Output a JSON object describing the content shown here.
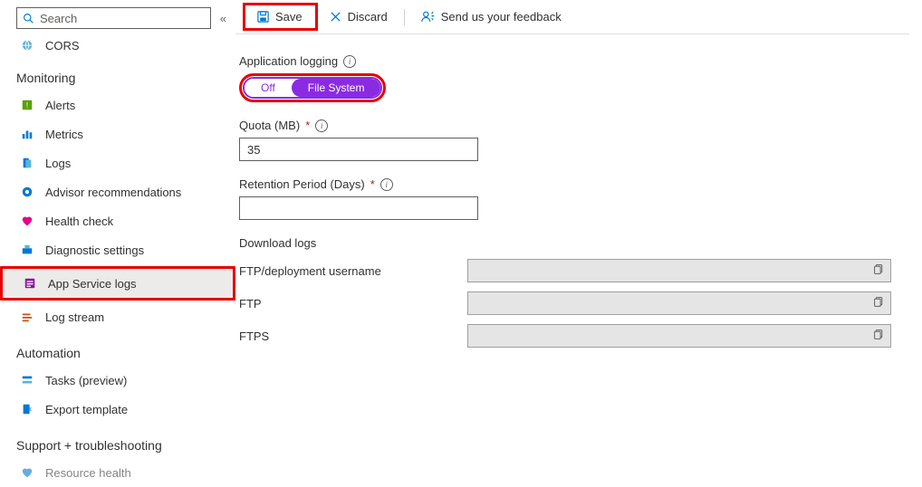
{
  "search": {
    "placeholder": "Search"
  },
  "sidebar": {
    "top_item": {
      "label": "CORS"
    },
    "sections": [
      {
        "title": "Monitoring",
        "items": [
          {
            "label": "Alerts",
            "icon": "alerts"
          },
          {
            "label": "Metrics",
            "icon": "metrics"
          },
          {
            "label": "Logs",
            "icon": "logs"
          },
          {
            "label": "Advisor recommendations",
            "icon": "advisor"
          },
          {
            "label": "Health check",
            "icon": "health"
          },
          {
            "label": "Diagnostic settings",
            "icon": "diagnostic"
          },
          {
            "label": "App Service logs",
            "icon": "appservicelogs",
            "selected": true,
            "highlighted": true
          },
          {
            "label": "Log stream",
            "icon": "logstream"
          }
        ]
      },
      {
        "title": "Automation",
        "items": [
          {
            "label": "Tasks (preview)",
            "icon": "tasks"
          },
          {
            "label": "Export template",
            "icon": "export"
          }
        ]
      },
      {
        "title": "Support + troubleshooting",
        "items": [
          {
            "label": "Resource health",
            "icon": "resourcehealth"
          }
        ]
      }
    ]
  },
  "toolbar": {
    "save": "Save",
    "discard": "Discard",
    "feedback": "Send us your feedback"
  },
  "form": {
    "app_logging_label": "Application logging",
    "toggle": {
      "off": "Off",
      "on": "File System",
      "selected": "on"
    },
    "quota_label": "Quota (MB)",
    "quota_value": "35",
    "retention_label": "Retention Period (Days)",
    "retention_value": "",
    "download_title": "Download logs",
    "rows": [
      {
        "label": "FTP/deployment username",
        "value": ""
      },
      {
        "label": "FTP",
        "value": ""
      },
      {
        "label": "FTPS",
        "value": ""
      }
    ]
  },
  "colors": {
    "accent": "#8a2be2",
    "highlight": "#e60000",
    "azure_blue": "#0078d4"
  }
}
